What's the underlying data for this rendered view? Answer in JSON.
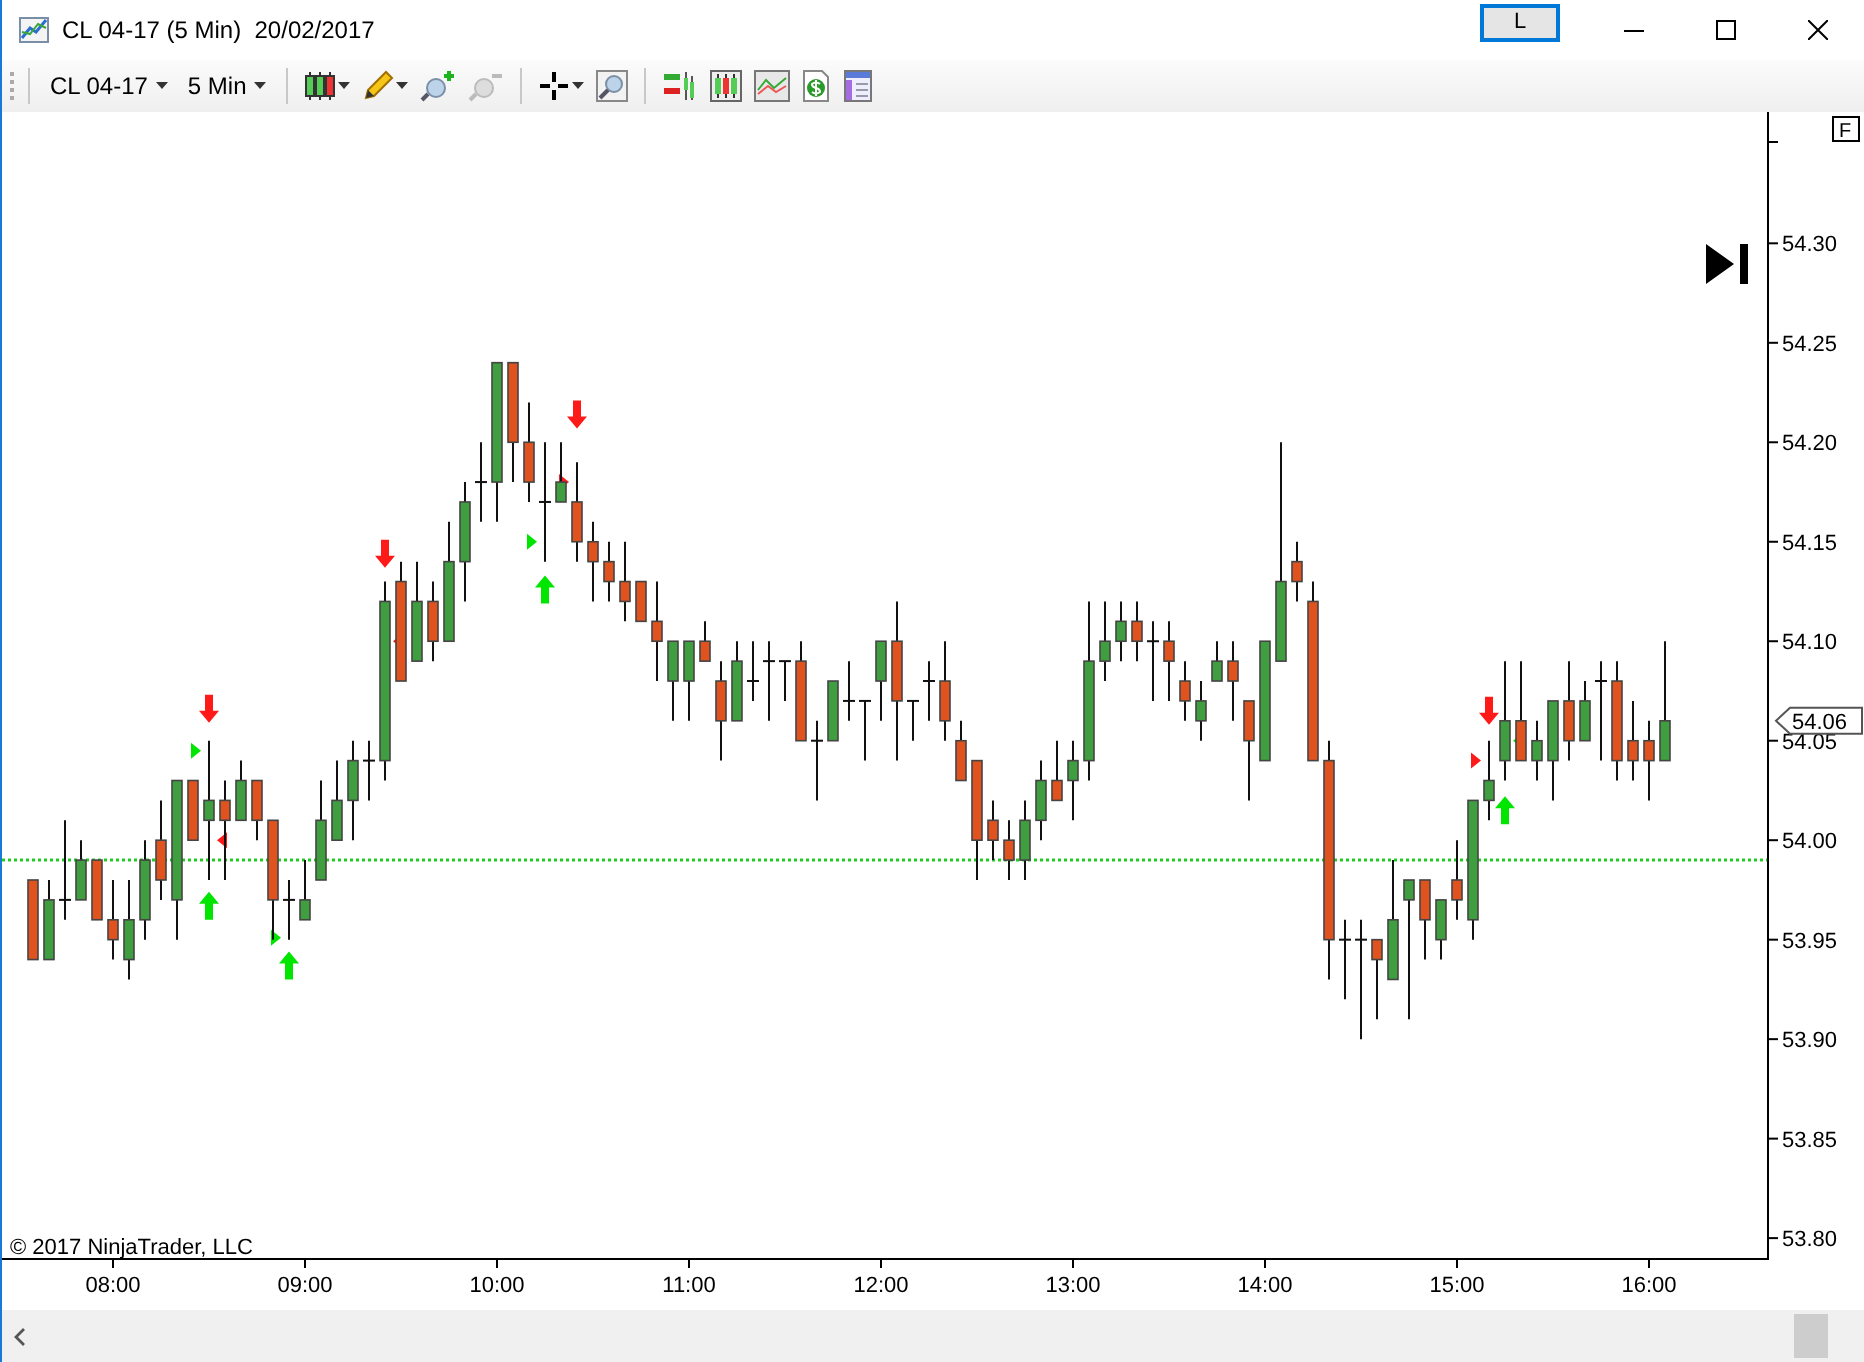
{
  "window": {
    "title": "CL 04-17 (5 Min)  20/02/2017",
    "layout_button": "L"
  },
  "toolbar": {
    "instrument": "CL 04-17",
    "interval": "5 Min"
  },
  "chart": {
    "axis_button": "F",
    "price_marker": "54.06",
    "copyright": "© 2017 NinjaTrader, LLC",
    "chart_data": {
      "type": "candlestick",
      "ylim": [
        53.789,
        54.366
      ],
      "yticks": [
        {
          "value": 53.8,
          "label": "53.80"
        },
        {
          "value": 53.85,
          "label": "53.85"
        },
        {
          "value": 53.9,
          "label": "53.90"
        },
        {
          "value": 53.95,
          "label": "53.95"
        },
        {
          "value": 54.0,
          "label": "54.00"
        },
        {
          "value": 54.05,
          "label": "54.05"
        },
        {
          "value": 54.1,
          "label": "54.10"
        },
        {
          "value": 54.15,
          "label": "54.15"
        },
        {
          "value": 54.2,
          "label": "54.20"
        },
        {
          "value": 54.25,
          "label": "54.25"
        },
        {
          "value": 54.3,
          "label": "54.30"
        }
      ],
      "categories": [
        null,
        null,
        null,
        null,
        null,
        "08:00",
        null,
        null,
        null,
        null,
        null,
        null,
        null,
        null,
        null,
        null,
        null,
        "09:00",
        null,
        null,
        null,
        null,
        null,
        null,
        null,
        null,
        null,
        null,
        null,
        "10:00",
        null,
        null,
        null,
        null,
        null,
        null,
        null,
        null,
        null,
        null,
        null,
        "11:00",
        null,
        null,
        null,
        null,
        null,
        null,
        null,
        null,
        null,
        null,
        null,
        "12:00",
        null,
        null,
        null,
        null,
        null,
        null,
        null,
        null,
        null,
        null,
        null,
        "13:00",
        null,
        null,
        null,
        null,
        null,
        null,
        null,
        null,
        null,
        null,
        null,
        "14:00",
        null,
        null,
        null,
        null,
        null,
        null,
        null,
        null,
        null,
        null,
        null,
        "15:00",
        null,
        null,
        null,
        null,
        null,
        null,
        null,
        null,
        null,
        null,
        null,
        "16:00",
        null
      ],
      "ohlc": [
        [
          53.98,
          53.98,
          53.94,
          53.94
        ],
        [
          53.94,
          53.98,
          53.94,
          53.97
        ],
        [
          53.97,
          54.01,
          53.96,
          53.97
        ],
        [
          53.97,
          54.0,
          53.97,
          53.99
        ],
        [
          53.99,
          53.99,
          53.96,
          53.96
        ],
        [
          53.96,
          53.98,
          53.94,
          53.95
        ],
        [
          53.94,
          53.98,
          53.93,
          53.96
        ],
        [
          53.96,
          54.0,
          53.95,
          53.99
        ],
        [
          54.0,
          54.02,
          53.97,
          53.98
        ],
        [
          53.97,
          54.03,
          53.95,
          54.03
        ],
        [
          54.03,
          54.03,
          54.0,
          54.0
        ],
        [
          54.01,
          54.05,
          53.98,
          54.02
        ],
        [
          54.02,
          54.03,
          53.98,
          54.01
        ],
        [
          54.01,
          54.04,
          54.01,
          54.03
        ],
        [
          54.03,
          54.03,
          54.0,
          54.01
        ],
        [
          54.01,
          54.01,
          53.95,
          53.97
        ],
        [
          53.97,
          53.98,
          53.95,
          53.97
        ],
        [
          53.96,
          53.99,
          53.96,
          53.97
        ],
        [
          53.98,
          54.03,
          53.98,
          54.01
        ],
        [
          54.0,
          54.04,
          54.0,
          54.02
        ],
        [
          54.02,
          54.05,
          54.0,
          54.04
        ],
        [
          54.04,
          54.05,
          54.02,
          54.04
        ],
        [
          54.04,
          54.13,
          54.03,
          54.12
        ],
        [
          54.13,
          54.14,
          54.08,
          54.08
        ],
        [
          54.09,
          54.14,
          54.09,
          54.12
        ],
        [
          54.12,
          54.13,
          54.09,
          54.1
        ],
        [
          54.1,
          54.16,
          54.1,
          54.14
        ],
        [
          54.14,
          54.18,
          54.12,
          54.17
        ],
        [
          54.18,
          54.2,
          54.16,
          54.18
        ],
        [
          54.18,
          54.24,
          54.16,
          54.24
        ],
        [
          54.24,
          54.24,
          54.18,
          54.2
        ],
        [
          54.2,
          54.22,
          54.17,
          54.18
        ],
        [
          54.17,
          54.2,
          54.14,
          54.17
        ],
        [
          54.17,
          54.2,
          54.17,
          54.18
        ],
        [
          54.17,
          54.19,
          54.14,
          54.15
        ],
        [
          54.15,
          54.16,
          54.12,
          54.14
        ],
        [
          54.14,
          54.15,
          54.12,
          54.13
        ],
        [
          54.13,
          54.15,
          54.11,
          54.12
        ],
        [
          54.13,
          54.13,
          54.11,
          54.11
        ],
        [
          54.11,
          54.13,
          54.08,
          54.1
        ],
        [
          54.08,
          54.1,
          54.06,
          54.1
        ],
        [
          54.08,
          54.1,
          54.06,
          54.1
        ],
        [
          54.1,
          54.11,
          54.09,
          54.09
        ],
        [
          54.08,
          54.09,
          54.04,
          54.06
        ],
        [
          54.06,
          54.1,
          54.06,
          54.09
        ],
        [
          54.08,
          54.1,
          54.07,
          54.08
        ],
        [
          54.09,
          54.1,
          54.06,
          54.09
        ],
        [
          54.09,
          54.09,
          54.07,
          54.09
        ],
        [
          54.09,
          54.1,
          54.05,
          54.05
        ],
        [
          54.05,
          54.06,
          54.02,
          54.05
        ],
        [
          54.05,
          54.08,
          54.05,
          54.08
        ],
        [
          54.07,
          54.09,
          54.06,
          54.07
        ],
        [
          54.07,
          54.07,
          54.04,
          54.07
        ],
        [
          54.08,
          54.1,
          54.06,
          54.1
        ],
        [
          54.1,
          54.12,
          54.04,
          54.07
        ],
        [
          54.07,
          54.07,
          54.05,
          54.07
        ],
        [
          54.08,
          54.09,
          54.06,
          54.08
        ],
        [
          54.08,
          54.1,
          54.05,
          54.06
        ],
        [
          54.05,
          54.06,
          54.03,
          54.03
        ],
        [
          54.04,
          54.04,
          53.98,
          54.0
        ],
        [
          54.01,
          54.02,
          53.99,
          54.0
        ],
        [
          54.0,
          54.01,
          53.98,
          53.99
        ],
        [
          53.99,
          54.02,
          53.98,
          54.01
        ],
        [
          54.01,
          54.04,
          54.0,
          54.03
        ],
        [
          54.03,
          54.05,
          54.02,
          54.02
        ],
        [
          54.03,
          54.05,
          54.01,
          54.04
        ],
        [
          54.04,
          54.12,
          54.03,
          54.09
        ],
        [
          54.09,
          54.12,
          54.08,
          54.1
        ],
        [
          54.1,
          54.12,
          54.09,
          54.11
        ],
        [
          54.11,
          54.12,
          54.09,
          54.1
        ],
        [
          54.1,
          54.11,
          54.07,
          54.1
        ],
        [
          54.1,
          54.11,
          54.07,
          54.09
        ],
        [
          54.08,
          54.09,
          54.06,
          54.07
        ],
        [
          54.06,
          54.08,
          54.05,
          54.07
        ],
        [
          54.08,
          54.1,
          54.08,
          54.09
        ],
        [
          54.09,
          54.1,
          54.06,
          54.08
        ],
        [
          54.07,
          54.07,
          54.02,
          54.05
        ],
        [
          54.04,
          54.1,
          54.04,
          54.1
        ],
        [
          54.09,
          54.2,
          54.09,
          54.13
        ],
        [
          54.14,
          54.15,
          54.12,
          54.13
        ],
        [
          54.12,
          54.13,
          54.04,
          54.04
        ],
        [
          54.04,
          54.05,
          53.93,
          53.95
        ],
        [
          53.95,
          53.96,
          53.92,
          53.95
        ],
        [
          53.95,
          53.96,
          53.9,
          53.95
        ],
        [
          53.95,
          53.95,
          53.91,
          53.94
        ],
        [
          53.93,
          53.99,
          53.93,
          53.96
        ],
        [
          53.97,
          53.98,
          53.91,
          53.98
        ],
        [
          53.98,
          53.98,
          53.94,
          53.96
        ],
        [
          53.95,
          53.97,
          53.94,
          53.97
        ],
        [
          53.98,
          54.0,
          53.96,
          53.97
        ],
        [
          53.96,
          54.02,
          53.95,
          54.02
        ],
        [
          54.02,
          54.05,
          54.01,
          54.03
        ],
        [
          54.04,
          54.09,
          54.03,
          54.06
        ],
        [
          54.06,
          54.09,
          54.04,
          54.04
        ],
        [
          54.04,
          54.06,
          54.03,
          54.05
        ],
        [
          54.04,
          54.07,
          54.02,
          54.07
        ],
        [
          54.07,
          54.09,
          54.04,
          54.05
        ],
        [
          54.05,
          54.08,
          54.05,
          54.07
        ],
        [
          54.08,
          54.09,
          54.04,
          54.08
        ],
        [
          54.08,
          54.09,
          54.03,
          54.04
        ],
        [
          54.05,
          54.07,
          54.03,
          54.04
        ],
        [
          54.05,
          54.06,
          54.02,
          54.04
        ],
        [
          54.04,
          54.1,
          54.04,
          54.06
        ]
      ],
      "ref_lines": [
        {
          "axis": "y",
          "value": 53.99
        }
      ]
    },
    "signals": [
      {
        "kind": "sell-arrow"
      },
      {
        "kind": "buy-triangle-right"
      },
      {
        "kind": "sell-triangle-left"
      },
      {
        "kind": "buy-arrow"
      },
      {
        "kind": "buy-triangle-right"
      },
      {
        "kind": "buy-arrow"
      },
      {
        "kind": "sell-arrow"
      },
      {
        "kind": "sell-triangle-left"
      },
      {
        "kind": "buy-triangle-right"
      },
      {
        "kind": "buy-arrow"
      },
      {
        "kind": "sell-arrow"
      },
      {
        "kind": "sell-triangle-right"
      },
      {
        "kind": "sell-arrow"
      },
      {
        "kind": "sell-triangle-right"
      },
      {
        "kind": "buy-triangle-left"
      },
      {
        "kind": "buy-arrow"
      }
    ]
  }
}
